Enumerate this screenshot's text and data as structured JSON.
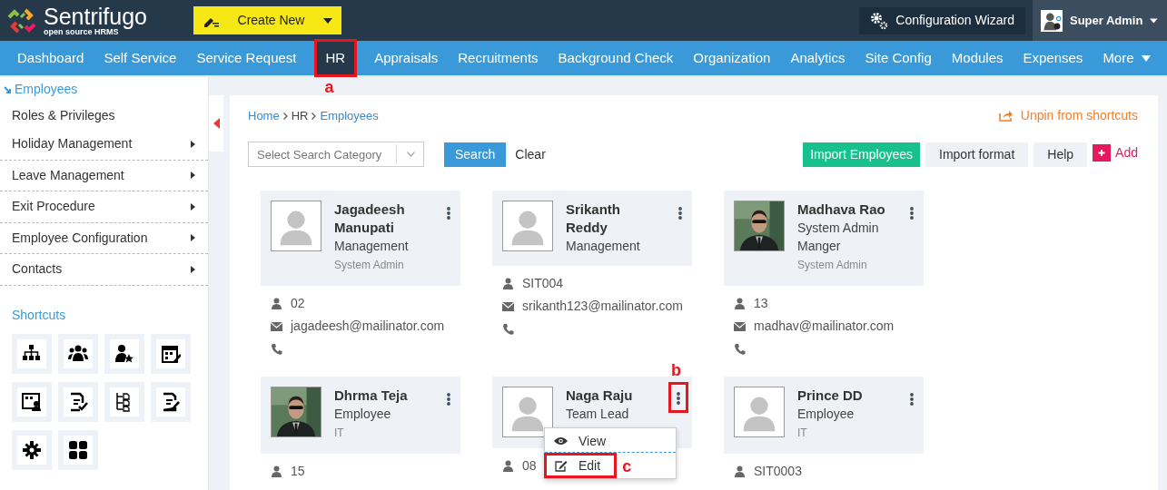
{
  "brand": {
    "name": "Sentrifugo",
    "tagline": "open source HRMS"
  },
  "create_button": "Create New",
  "config_button": "Configuration Wizard",
  "user": "Super Admin",
  "nav": [
    {
      "label": "Dashboard",
      "selected": false
    },
    {
      "label": "Self Service",
      "selected": false
    },
    {
      "label": "Service Request",
      "selected": false
    },
    {
      "label": "HR",
      "selected": true,
      "callout": "a"
    },
    {
      "label": "Appraisals",
      "selected": false
    },
    {
      "label": "Recruitments",
      "selected": false
    },
    {
      "label": "Background Check",
      "selected": false
    },
    {
      "label": "Organization",
      "selected": false
    },
    {
      "label": "Analytics",
      "selected": false
    },
    {
      "label": "Site Config",
      "selected": false
    },
    {
      "label": "Modules",
      "selected": false
    },
    {
      "label": "Expenses",
      "selected": false
    }
  ],
  "nav_more": "More",
  "sidebar": {
    "active": "Employees",
    "items": [
      {
        "label": "Roles & Privileges",
        "expandable": false
      },
      {
        "label": "Holiday Management",
        "expandable": true
      },
      {
        "label": "Leave Management",
        "expandable": true
      },
      {
        "label": "Exit Procedure",
        "expandable": true
      },
      {
        "label": "Employee Configuration",
        "expandable": true
      },
      {
        "label": "Contacts",
        "expandable": true
      }
    ],
    "shortcuts_title": "Shortcuts",
    "shortcuts": [
      {
        "kind": "org"
      },
      {
        "kind": "group"
      },
      {
        "kind": "userstar"
      },
      {
        "kind": "calendar"
      },
      {
        "kind": "idcard"
      },
      {
        "kind": "doccheck"
      },
      {
        "kind": "tree"
      },
      {
        "kind": "docedit"
      },
      {
        "kind": "gear"
      },
      {
        "kind": "grid"
      }
    ]
  },
  "breadcrumb": [
    "Home",
    "HR",
    "Employees"
  ],
  "unpin": "Unpin from shortcuts",
  "search": {
    "placeholder": "Select Search Category",
    "button": "Search",
    "clear": "Clear"
  },
  "actions": [
    {
      "label": "Import Employees",
      "kind": "primary"
    },
    {
      "label": "Import format",
      "kind": "secondary"
    },
    {
      "label": "Help",
      "kind": "secondary"
    },
    {
      "label": "Add",
      "kind": "add"
    }
  ],
  "employees": [
    {
      "name": "Jagadeesh Manupati",
      "role": "Management",
      "department": "System Admin",
      "id": "02",
      "email": "jagadeesh@mailinator.com",
      "photo": false,
      "menu_open": false
    },
    {
      "name": "Srikanth Reddy",
      "role": "Management",
      "id": "SIT004",
      "email": "srikanth123@mailinator.com",
      "photo": false,
      "menu_open": false
    },
    {
      "name": "Madhava Rao",
      "role": "System Admin Manger",
      "department": "System Admin",
      "id": "13",
      "email": "madhav@mailinator.com",
      "photo": true,
      "menu_open": false
    },
    {
      "name": "Dhrma Teja",
      "role": "Employee",
      "department": "IT",
      "id": "15",
      "photo": true,
      "menu_open": false
    },
    {
      "name": "Naga Raju",
      "role": "Team Lead",
      "id": "08",
      "photo": false,
      "menu_open": true,
      "callout": "b"
    },
    {
      "name": "Prince DD",
      "role": "Employee",
      "department": "IT",
      "id": "SIT0003",
      "photo": false,
      "menu_open": false
    }
  ],
  "card_menu": [
    {
      "label": "View",
      "kind": "view"
    },
    {
      "label": "Edit",
      "kind": "edit",
      "callout": "c"
    }
  ]
}
